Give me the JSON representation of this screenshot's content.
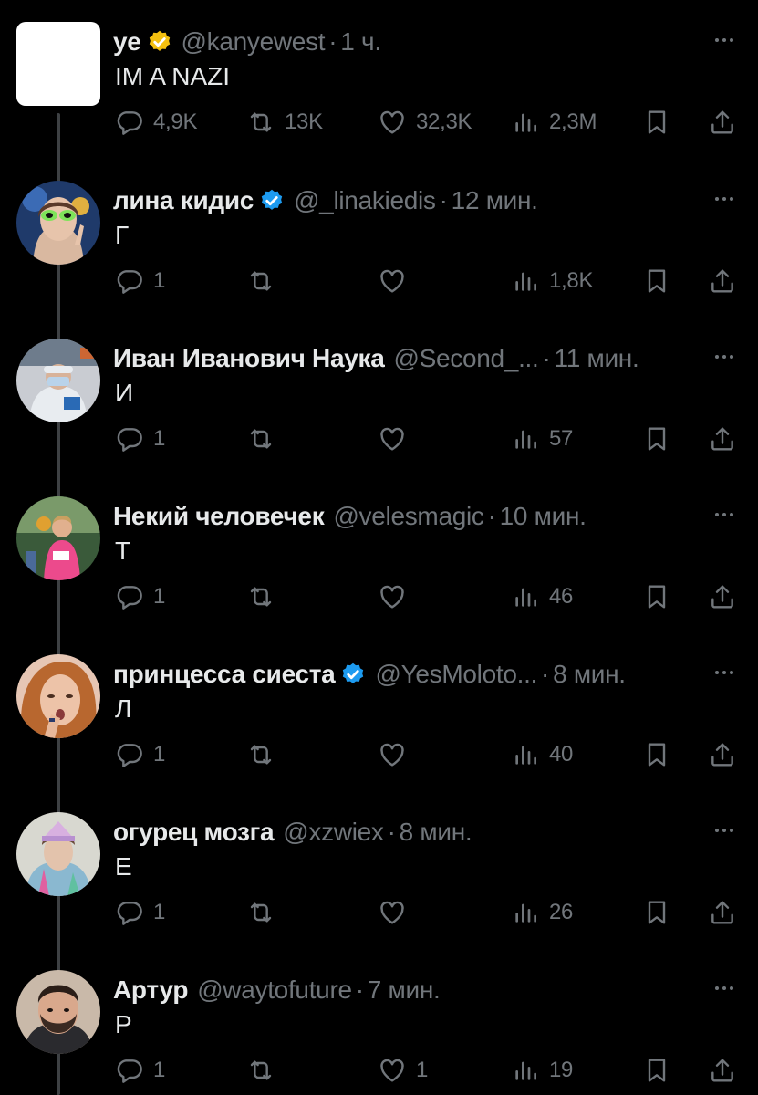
{
  "tweets": [
    {
      "name": "ye",
      "verified": true,
      "verified_color": "#f4c010",
      "handle": "@kanyewest",
      "dot": "·",
      "time": "1 ч.",
      "text": "IM A NAZI",
      "avatar": "blank-white-avatar",
      "stats": {
        "replies": "4,9K",
        "retweets": "13K",
        "likes": "32,3K",
        "views": "2,3M"
      }
    },
    {
      "name": "лина кидис",
      "verified": true,
      "verified_color": "#1d9bf0",
      "handle": "@_linakiedis",
      "dot": "·",
      "time": "12 мин.",
      "text": "Г",
      "avatar": "alien-glasses-avatar",
      "stats": {
        "replies": "1",
        "retweets": "",
        "likes": "",
        "views": "1,8K"
      }
    },
    {
      "name": "Иван Иванович Наука",
      "verified": false,
      "handle": "@Second_...",
      "dot": "·",
      "time": "11 мин.",
      "text": "И",
      "avatar": "lab-coat-avatar",
      "stats": {
        "replies": "1",
        "retweets": "",
        "likes": "",
        "views": "57"
      }
    },
    {
      "name": "Некий человечек",
      "verified": false,
      "handle": "@velesmagic",
      "dot": "·",
      "time": "10 мин.",
      "text": "Т",
      "avatar": "runner-avatar",
      "stats": {
        "replies": "1",
        "retweets": "",
        "likes": "",
        "views": "46"
      }
    },
    {
      "name": "принцесса сиеста",
      "verified": true,
      "verified_color": "#1d9bf0",
      "handle": "@YesMoloto...",
      "dot": "·",
      "time": "8 мин.",
      "text": "Л",
      "avatar": "redhead-avatar",
      "stats": {
        "replies": "1",
        "retweets": "",
        "likes": "",
        "views": "40"
      }
    },
    {
      "name": "огурец мозга",
      "verified": false,
      "handle": "@xzwiex",
      "dot": "·",
      "time": "8 мин.",
      "text": "Е",
      "avatar": "party-hat-avatar",
      "stats": {
        "replies": "1",
        "retweets": "",
        "likes": "",
        "views": "26"
      }
    },
    {
      "name": "Артур",
      "verified": false,
      "handle": "@waytofuture",
      "dot": "·",
      "time": "7 мин.",
      "text": "Р",
      "avatar": "bearded-man-avatar",
      "stats": {
        "replies": "1",
        "retweets": "",
        "likes": "1",
        "views": "19"
      }
    }
  ],
  "colors": {
    "background": "#000000",
    "text": "#e7e9ea",
    "muted": "#71767b",
    "thread_line": "#3e4144"
  }
}
